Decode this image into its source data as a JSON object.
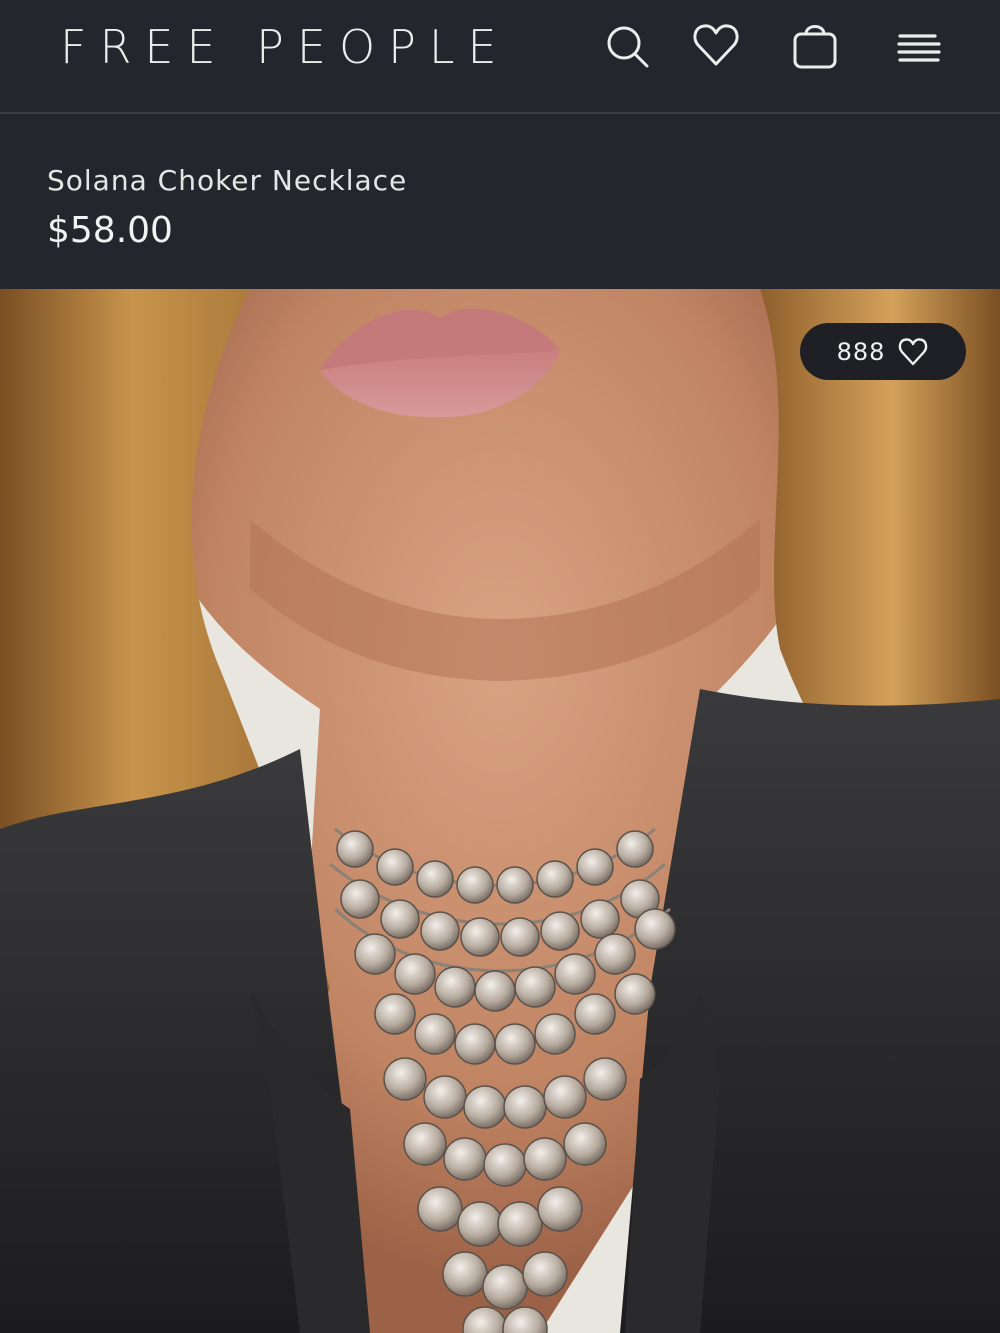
{
  "header": {
    "logo_text": "FREE PEOPLE",
    "icons": {
      "search": "search-icon",
      "favorites": "heart-icon",
      "bag": "shopping-bag-icon",
      "menu": "hamburger-menu-icon"
    }
  },
  "product": {
    "name": "Solana Choker Necklace",
    "price": "$58.00"
  },
  "gallery": {
    "like_count": "888",
    "like_icon": "heart-outline-icon"
  },
  "colors": {
    "header_bg": "#25262d",
    "text_light": "#ececec",
    "pill_bg": "#1f2026"
  }
}
